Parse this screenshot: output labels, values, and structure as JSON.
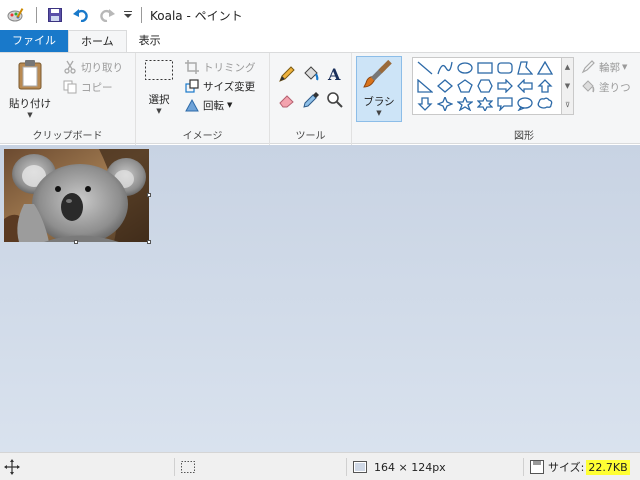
{
  "window": {
    "title": "Koala - ペイント"
  },
  "tabs": {
    "file": "ファイル",
    "home": "ホーム",
    "view": "表示"
  },
  "clipboard": {
    "paste": "貼り付け",
    "cut": "切り取り",
    "copy": "コピー",
    "group_label": "クリップボード"
  },
  "image": {
    "select": "選択",
    "crop": "トリミング",
    "resize": "サイズ変更",
    "rotate": "回転",
    "group_label": "イメージ"
  },
  "tools": {
    "group_label": "ツール"
  },
  "brush": {
    "label": "ブラシ"
  },
  "shapes": {
    "outline": "輪郭",
    "fill": "塗りつ",
    "group_label": "図形"
  },
  "status": {
    "dimensions": "164 × 124px",
    "size_label": "サイズ:",
    "size_value": "22.7KB"
  },
  "colors": {
    "accent": "#1979ca",
    "highlight": "#ffff33",
    "workspace": "#d0dae8"
  }
}
